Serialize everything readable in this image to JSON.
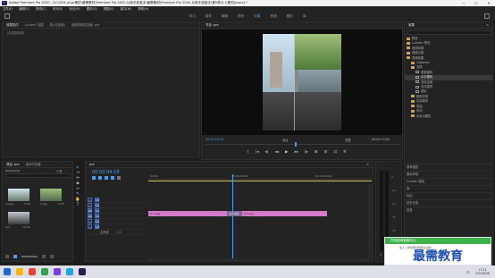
{
  "window": {
    "title": "Adobe Premiere Pro 2020 - D:\\2024 pr\\pr素材\\最需素材\\Premiere Pro 2020 从新手到高手\\最需素材\\Premiere Pro 2020 从新手到高手\\第5章\\5.1\\素材\\prproj *",
    "app_icon_label": "Pr",
    "btn_min": "—",
    "btn_max": "☐",
    "btn_close": "✕"
  },
  "menu": [
    "文件(F)",
    "编辑(E)",
    "剪辑(C)",
    "序列(S)",
    "标记(M)",
    "图形(G)",
    "视图(V)",
    "窗口(W)",
    "帮助(H)"
  ],
  "workspaces": [
    "学习",
    "组件",
    "编辑",
    "颜色",
    "效果",
    "音频",
    "图形",
    "库"
  ],
  "active_workspace": "效果",
  "source_panel": {
    "tabs": [
      "效果控件",
      "Lumetri 范围",
      "源:(无剪辑)",
      "音频剪辑混合器: pre"
    ],
    "active_tab": "效果控件",
    "empty_message": "(未选择剪辑)"
  },
  "program_monitor": {
    "tab": "节目: pre",
    "timecode_left": "00:00:04:18",
    "fit": "适合",
    "quality": "完整",
    "timecode_right": "00:00:10:00",
    "transport": [
      "{",
      "|◂",
      "◂|",
      "◂◂",
      "▶",
      "▸▸",
      "|▸",
      "⊞",
      "⊟",
      "⊡",
      "✲"
    ]
  },
  "effects_panel": {
    "tab": "效果",
    "menu_icon": "≡",
    "items": [
      {
        "label": "预设",
        "type": "folder",
        "indent": 0
      },
      {
        "label": "Lumetri 预设",
        "type": "folder",
        "indent": 0
      },
      {
        "label": "音频效果",
        "type": "folder",
        "indent": 0
      },
      {
        "label": "音频过渡",
        "type": "folder",
        "indent": 0
      },
      {
        "label": "视频效果",
        "type": "folder",
        "indent": 0
      },
      {
        "label": "Obsolete",
        "type": "folder",
        "indent": 1
      },
      {
        "label": "变换",
        "type": "folder",
        "indent": 1
      },
      {
        "label": "垂直翻转",
        "type": "fx",
        "indent": 2
      },
      {
        "label": "水平翻转",
        "type": "fx",
        "indent": 2,
        "selected": true
      },
      {
        "label": "羽化边缘",
        "type": "fx",
        "indent": 2
      },
      {
        "label": "自动重构",
        "type": "fx",
        "indent": 2
      },
      {
        "label": "裁剪",
        "type": "fx",
        "indent": 2
      },
      {
        "label": "图像控制",
        "type": "folder",
        "indent": 1
      },
      {
        "label": "实用程序",
        "type": "folder",
        "indent": 1
      },
      {
        "label": "扭曲",
        "type": "folder",
        "indent": 1
      },
      {
        "label": "时间",
        "type": "folder",
        "indent": 1
      },
      {
        "label": "杂色与颗粒",
        "type": "folder",
        "indent": 1
      }
    ],
    "sections": [
      "基本图形",
      "基本声音",
      "Lumetri 颜色",
      "库",
      "标记",
      "历史记录",
      "信息"
    ]
  },
  "project_panel": {
    "tabs": [
      "项目: pre",
      "媒体浏览器"
    ],
    "active_tab": "项目: pre",
    "file_name": "pre.prproj",
    "count": "3 项",
    "search_placeholder": "",
    "items": [
      {
        "name": "image",
        "duration": "5:00"
      },
      {
        "name": "5.jpg",
        "duration": "5:00"
      },
      {
        "name": "pre",
        "duration": "10:00"
      }
    ]
  },
  "timeline": {
    "tab": "pre",
    "menu_icon": "≡",
    "timecode": "00:00:04:18",
    "ruler": [
      "00:00",
      "00:00:05:00",
      "00:00:10:00"
    ],
    "tracks": [
      "V3",
      "V2",
      "V1",
      "A1",
      "A2",
      "A3"
    ],
    "master_label": "主声道",
    "master_value": "0.0",
    "clips": [
      {
        "name": "fx 5.jpg",
        "track": "V1"
      },
      {
        "name": "fx 5.jpg",
        "track": "V1"
      },
      {
        "name": "fx 5.jpg",
        "track": "V1"
      }
    ],
    "transition_label": "交叉溶解"
  },
  "tools": [
    "▸",
    "⇥",
    "⇹",
    "◆",
    "↔",
    "✎",
    "✋",
    "T"
  ],
  "audio_meter": {
    "labels": [
      "0",
      "-12",
      "-24",
      "-36",
      "-48",
      "dB"
    ],
    "s_label": "S",
    "s_label2": "S"
  },
  "watermark": {
    "banner": "在线咨询客服中心",
    "small_text": "加入二群加群领取更多资料",
    "main": "最需教育"
  },
  "taskbar": {
    "time": "17:23",
    "date": "2023/6/28",
    "lang": "中",
    "colors": [
      "#1e66d6",
      "#ffb400",
      "#e8403a",
      "#2ea44f",
      "#7b3fe4",
      "#1aa6d6",
      "#2a1a4d"
    ]
  }
}
